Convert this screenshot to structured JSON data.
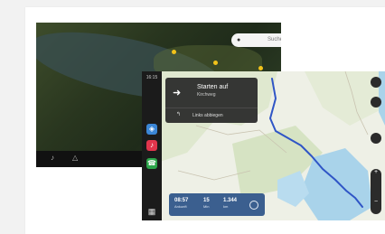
{
  "screen1": {
    "search_label": "Suchen",
    "search_icon": "pin-icon",
    "bar_icons": [
      "mic-icon",
      "bell-icon"
    ]
  },
  "screen2": {
    "rail_time": "16:15",
    "rail_apps": [
      "maps-icon",
      "music-icon",
      "phone-icon"
    ],
    "nav": {
      "maneuver_icon": "arrow-right-icon",
      "title": "Starten auf",
      "street": "Kirchweg",
      "next_instruction": "Links abbiegen"
    },
    "eta": {
      "arrival": "08:57",
      "arrival_label": "Ankunft",
      "duration": "15",
      "duration_label": "Min",
      "distance": "1.344",
      "distance_label": "km"
    },
    "route_color": "#2f55c6"
  }
}
